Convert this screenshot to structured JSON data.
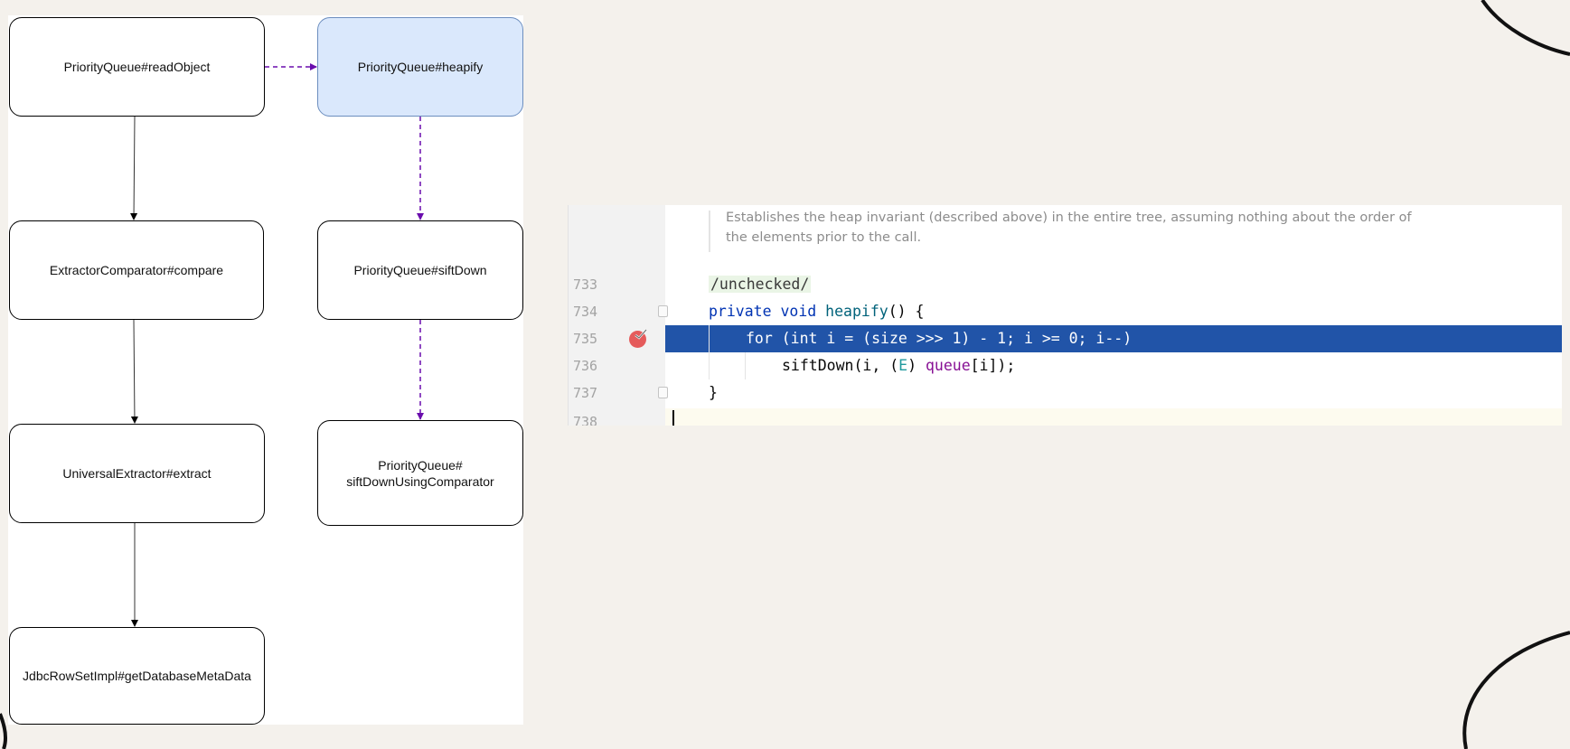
{
  "diagram": {
    "nodes": {
      "read_object": "PriorityQueue#readObject",
      "heapify": "PriorityQueue#heapify",
      "compare": "ExtractorComparator#compare",
      "sift_down": "PriorityQueue#siftDown",
      "extract": "UniversalExtractor#extract",
      "sift_down_cmp": "PriorityQueue#\nsiftDownUsingComparator",
      "get_meta": "JdbcRowSetImpl#getDatabaseMetaData"
    },
    "colors": {
      "highlight_fill": "#dae8fc",
      "highlight_border": "#6c8ebf",
      "dashed_arrow": "#6a0dad"
    }
  },
  "editor": {
    "doc_comment": [
      "Establishes the heap invariant (described above) in the entire tree, assuming nothing about the order of",
      "the elements prior to the call."
    ],
    "lines": [
      {
        "no": "733",
        "text": "/unchecked/"
      },
      {
        "no": "734",
        "kw1": "private",
        "kw2": "void",
        "fn": "heapify",
        "rest": "() {"
      },
      {
        "no": "735",
        "text": "for (int i = (size >>> 1) - 1; i >= 0; i--)"
      },
      {
        "no": "736",
        "call": "siftDown(i, (",
        "tparam": "E",
        "mid": ") ",
        "field": "queue",
        "end": "[i]);"
      },
      {
        "no": "737",
        "text": "}"
      },
      {
        "no": "738"
      }
    ],
    "selection_color": "#2154a8",
    "breakpoint_icon": "breakpoint-check-icon"
  }
}
